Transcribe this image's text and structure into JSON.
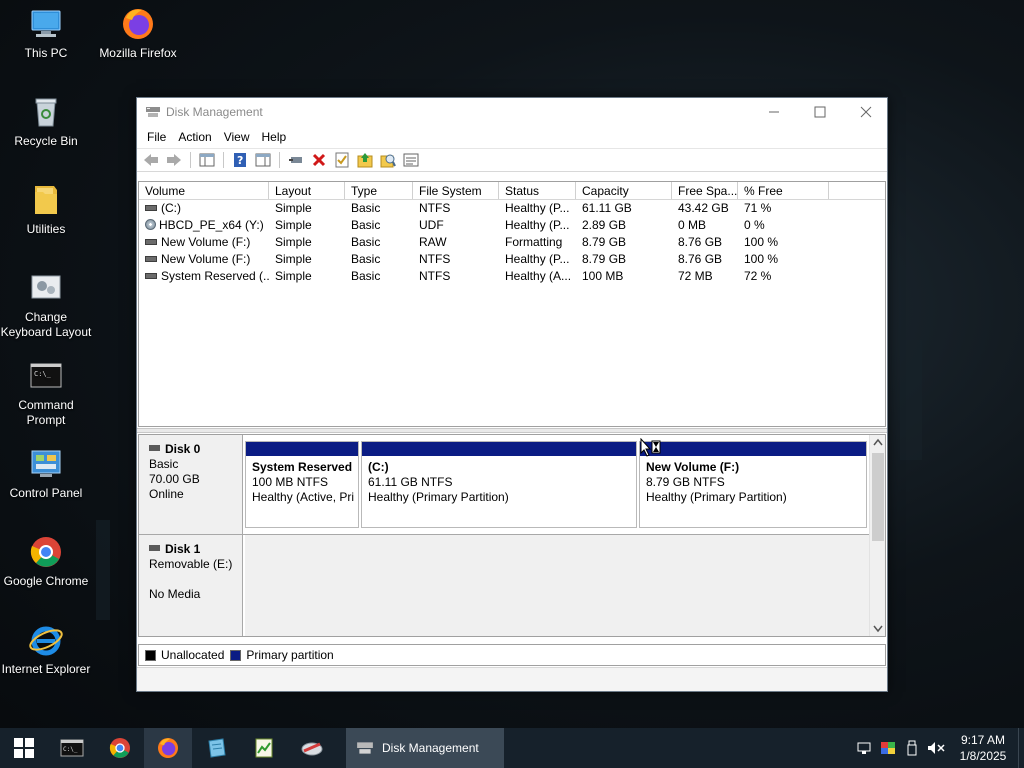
{
  "desktop": {
    "icons": [
      {
        "label": "This PC",
        "icon": "computer-icon"
      },
      {
        "label": "Mozilla Firefox",
        "icon": "firefox-icon"
      },
      {
        "label": "Recycle Bin",
        "icon": "recycle-bin-icon"
      },
      {
        "label": "Utilities",
        "icon": "folder-icon"
      },
      {
        "label": "Change Keyboard Layout",
        "icon": "keyboard-layout-icon"
      },
      {
        "label": "Command Prompt",
        "icon": "command-prompt-icon"
      },
      {
        "label": "Control Panel",
        "icon": "control-panel-icon"
      },
      {
        "label": "Google Chrome",
        "icon": "chrome-icon"
      },
      {
        "label": "Internet Explorer",
        "icon": "internet-explorer-icon"
      }
    ]
  },
  "window": {
    "title": "Disk Management",
    "menu": [
      "File",
      "Action",
      "View",
      "Help"
    ],
    "toolbar": [
      "back-icon",
      "forward-icon",
      "properties-pane-icon",
      "help-icon",
      "console-icon",
      "connect-icon",
      "delete-icon",
      "check-icon",
      "import-icon",
      "search-icon",
      "list-icon"
    ]
  },
  "volume_list": {
    "columns": [
      "Volume",
      "Layout",
      "Type",
      "File System",
      "Status",
      "Capacity",
      "Free Spa...",
      "% Free",
      ""
    ],
    "rows": [
      {
        "icon": "drive",
        "cells": [
          "(C:)",
          "Simple",
          "Basic",
          "NTFS",
          "Healthy (P...",
          "61.11 GB",
          "43.42 GB",
          "71 %"
        ]
      },
      {
        "icon": "cd",
        "cells": [
          "HBCD_PE_x64 (Y:)",
          "Simple",
          "Basic",
          "UDF",
          "Healthy (P...",
          "2.89 GB",
          "0 MB",
          "0 %"
        ]
      },
      {
        "icon": "drive",
        "cells": [
          "New Volume (F:)",
          "Simple",
          "Basic",
          "RAW",
          "Formatting",
          "8.79 GB",
          "8.76 GB",
          "100 %"
        ]
      },
      {
        "icon": "drive",
        "cells": [
          "New Volume (F:)",
          "Simple",
          "Basic",
          "NTFS",
          "Healthy (P...",
          "8.79 GB",
          "8.76 GB",
          "100 %"
        ]
      },
      {
        "icon": "drive",
        "cells": [
          "System Reserved (...",
          "Simple",
          "Basic",
          "NTFS",
          "Healthy (A...",
          "100 MB",
          "72 MB",
          "72 %"
        ]
      }
    ]
  },
  "disks": {
    "disk0": {
      "name": "Disk 0",
      "type": "Basic",
      "size": "70.00 GB",
      "state": "Online",
      "partitions": [
        {
          "name": "System Reserved",
          "size": "100 MB NTFS",
          "status": "Healthy (Active, Pri"
        },
        {
          "name": "(C:)",
          "size": "61.11 GB NTFS",
          "status": "Healthy (Primary Partition)"
        },
        {
          "name": "New Volume  (F:)",
          "size": "8.79 GB NTFS",
          "status": "Healthy (Primary Partition)"
        }
      ]
    },
    "disk1": {
      "name": "Disk 1",
      "type": "Removable (E:)",
      "media": "No Media"
    }
  },
  "legend": [
    {
      "label": "Unallocated",
      "color": "#000000"
    },
    {
      "label": "Primary partition",
      "color": "#0b1c84"
    }
  ],
  "taskbar": {
    "pinned": [
      "start-icon",
      "command-prompt-icon",
      "chrome-icon",
      "firefox-icon",
      "notepad-icon",
      "spreadsheet-icon",
      "disk-tool-icon"
    ],
    "active_window": "Disk Management",
    "clock_time": "9:17 AM",
    "clock_date": "1/8/2025"
  }
}
